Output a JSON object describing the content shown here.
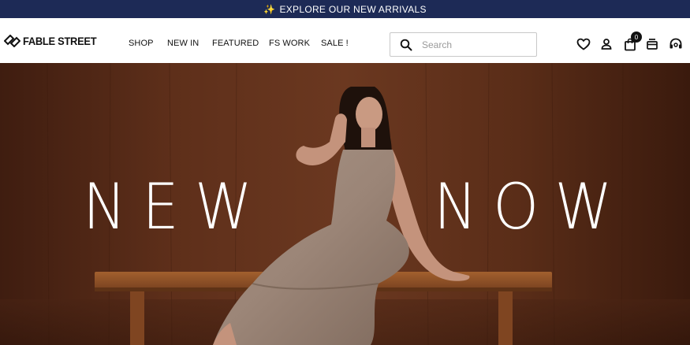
{
  "promo": {
    "icon": "sparkles-icon",
    "text": "EXPLORE OUR NEW ARRIVALS"
  },
  "brand": {
    "name": "FABLE STREET",
    "logo_icon": "diamond-logo-icon"
  },
  "nav": {
    "items": [
      {
        "label": "SHOP"
      },
      {
        "label": "NEW IN"
      },
      {
        "label": "FEATURED"
      },
      {
        "label": "FS WORK"
      },
      {
        "label": "SALE !"
      }
    ]
  },
  "search": {
    "placeholder": "Search",
    "value": "",
    "icon": "search-icon"
  },
  "header_icons": {
    "wishlist": "heart-icon",
    "account": "user-icon",
    "cart": "shopping-bag-icon",
    "cart_count": "0",
    "orders": "card-icon",
    "support": "headset-icon"
  },
  "hero": {
    "headline_left": "NEW",
    "headline_right": "NOW"
  },
  "colors": {
    "promo_bg": "#1d2a56",
    "accent_spark": "#f4c542",
    "hero_wood": "#5a2f1b",
    "text_dark": "#111111"
  }
}
